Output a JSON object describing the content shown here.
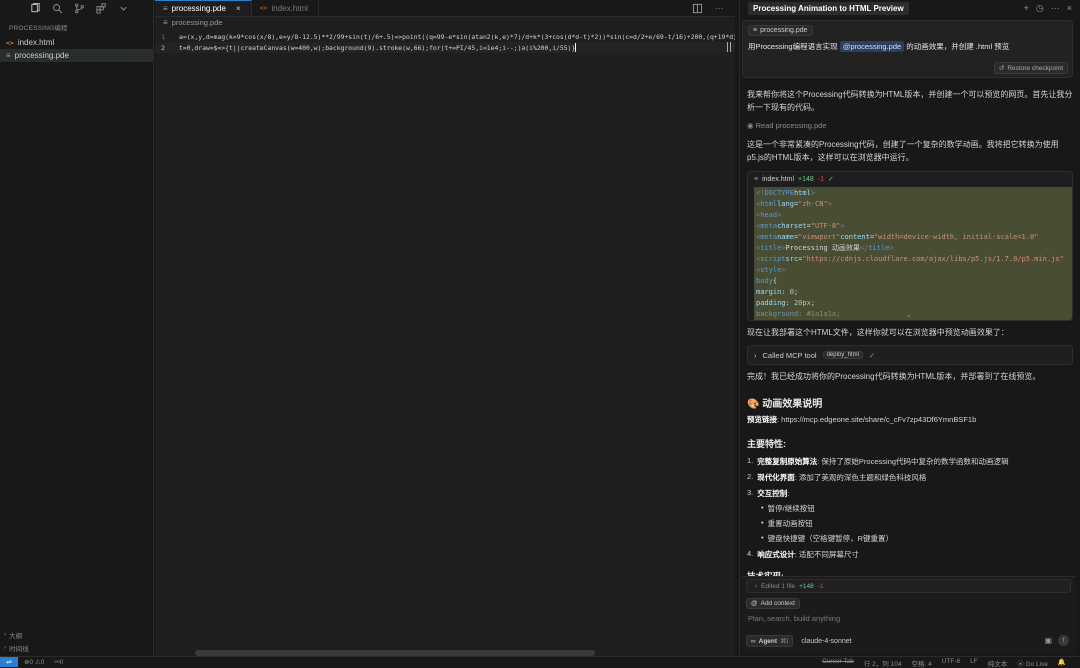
{
  "sidebar": {
    "project_title": "PROCESSING编程",
    "files": [
      {
        "name": "index.html",
        "type": "html"
      },
      {
        "name": "processing.pde",
        "type": "pde"
      }
    ],
    "outline_label": "大纲",
    "timeline_label": "时间线"
  },
  "editor": {
    "tabs": [
      {
        "label": "processing.pde",
        "active": true
      },
      {
        "label": "index.html",
        "active": false
      }
    ],
    "breadcrumb": "processing.pde",
    "lines": [
      {
        "num": "1",
        "text": "a=(x,y,d=mag(k=9*cos(x/8),e=y/8-12.5)**2/99+sin(t)/6+.5)=>point((q=99-e*sin(atan2(k,e)*7)/d+k*(3+cos(d*d-t)*2))*sin(c=d/2+e/69-t/16)+200,(q+19*d)*cos(c)+200)"
      },
      {
        "num": "2",
        "text": "t=0,draw=$=>{t||createCanvas(w=400,w);background(9).stroke(w,66);for(t+=PI/45,i=1e4;i--;)a(i%200,i/55)}"
      }
    ]
  },
  "chat": {
    "title": "Processing Animation to HTML Preview",
    "user_file_chip": "processing.pde",
    "user_message_before": "用Processing编程语言实现",
    "user_mention": "@processing.pde",
    "user_message_after": "的动画效果，并创建 .html 预览",
    "restore_label": "Restore checkpoint",
    "intro": "我来帮你将这个Processing代码转换为HTML版本，并创建一个可以预览的网页。首先让我分析一下现有的代码。",
    "read_label": "Read processing.pde",
    "analysis": "这是一个非常紧凑的Processing代码，创建了一个复杂的数学动画。我将把它转换为使用p5.js的HTML版本，这样可以在浏览器中运行。",
    "code_card": {
      "file": "index.html",
      "added": "+148",
      "removed": "-1"
    },
    "deploy_intro": "现在让我部署这个HTML文件，这样你就可以在浏览器中预览动画效果了：",
    "mcp_label": "Called MCP tool",
    "mcp_tool": "deploy_html",
    "done": "完成！我已经成功将你的Processing代码转换为HTML版本，并部署到了在线预览。",
    "section_title": "动画效果说明",
    "preview_label": "预览链接",
    "preview_url": "https://mcp.edgeone.site/share/c_cFv7zp43Df6YmnBSF1b",
    "features_title": "主要特性:",
    "features": [
      {
        "num": "1.",
        "bold": "完整复制原始算法",
        "text": ": 保持了原始Processing代码中复杂的数学函数和动画逻辑"
      },
      {
        "num": "2.",
        "bold": "现代化界面",
        "text": ": 添加了美观的深色主题和绿色科技风格"
      },
      {
        "num": "3.",
        "bold": "交互控制",
        "text": ":"
      },
      {
        "num": "4.",
        "bold": "响应式设计",
        "text": ": 适配不同屏幕尺寸"
      }
    ],
    "sub_features": [
      "暂停/继续按钮",
      "重置动画按钮",
      "键盘快捷键（空格键暂停，R键重置）"
    ],
    "tech_title_partial": "技术实现:",
    "edited_label": "Edited 1 file",
    "edited_added": "+148",
    "edited_removed": "-1",
    "add_context": "Add context",
    "placeholder": "Plan, search, build anything",
    "agent_label": "Agent",
    "agent_shortcut": "⌘I",
    "model": "claude-4-sonnet"
  },
  "statusbar": {
    "errors": "0",
    "warnings": "0",
    "ports": "0",
    "cursor_tab": "Cursor Tab",
    "position": "行 2，列 104",
    "spaces": "空格: 4",
    "encoding": "UTF-8",
    "eol": "LF",
    "language": "纯文本",
    "go_live": "Go Live"
  },
  "colors": {
    "accent": "#2a7fd4",
    "code_highlight": "#484d34",
    "added": "#73c991",
    "removed": "#f14c4c"
  }
}
